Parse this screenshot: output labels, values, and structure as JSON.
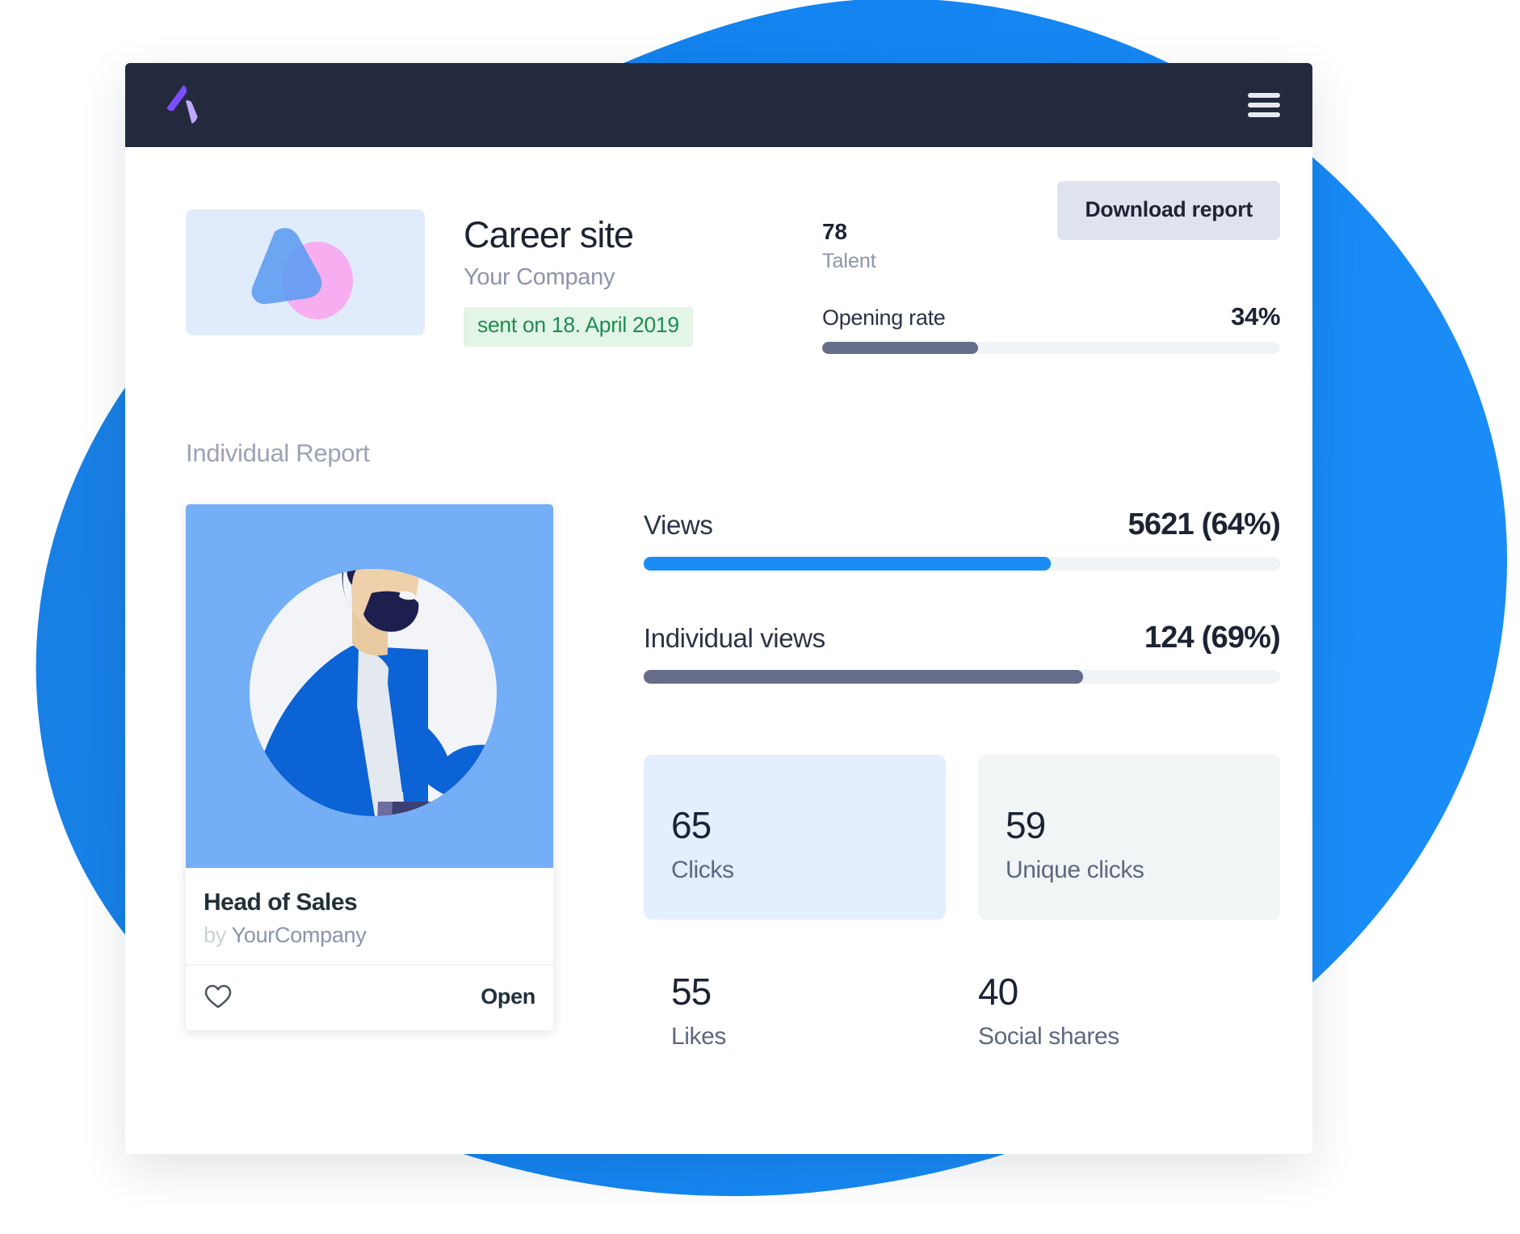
{
  "colors": {
    "bg_blob": "#1383ef",
    "titlebar": "#232a3d",
    "logo_dark": "#7c4dff",
    "logo_light": "#c2a8fb",
    "accent_blue": "#1a8cf5",
    "accent_slate": "#666d8a",
    "badge_bg": "#e2f5e6",
    "badge_text": "#1e8c52",
    "button_bg": "#dfe3ed",
    "card_clicks_bg": "#e3efff",
    "card_unique_bg": "#f1f5f5",
    "track_bg": "#f1f4f6",
    "illustration_bg": "#74aef7"
  },
  "titlebar": {
    "logo_icon": "arrow-logo-icon",
    "menu_icon": "hamburger-menu-icon"
  },
  "toolbar": {
    "download_label": "Download report"
  },
  "campaign": {
    "thumbnail_icon": "campaign-thumbnail-shapes",
    "title": "Career site",
    "company": "Your Company",
    "sent_badge": "sent on 18. April 2019",
    "talent_value": "78",
    "talent_label": "Talent",
    "opening_rate_label": "Opening rate",
    "opening_rate_value": "34%",
    "opening_rate_percent": 34
  },
  "individual_report": {
    "section_title": "Individual Report",
    "job_card": {
      "illustration_icon": "bearded-man-illustration",
      "title": "Head of Sales",
      "by_prefix": "by",
      "company": "YourCompany",
      "like_icon": "heart-outline-icon",
      "open_label": "Open"
    },
    "metrics": [
      {
        "name": "Views",
        "value": "5621 (64%)",
        "percent": 64,
        "color": "#1a8cf5"
      },
      {
        "name": "Individual views",
        "value": "124 (69%)",
        "percent": 69,
        "color": "#666d8a"
      }
    ],
    "stat_cards": [
      {
        "number": "65",
        "label": "Clicks"
      },
      {
        "number": "59",
        "label": "Unique clicks"
      }
    ],
    "plain_stats": [
      {
        "number": "55",
        "label": "Likes"
      },
      {
        "number": "40",
        "label": "Social shares"
      }
    ]
  }
}
